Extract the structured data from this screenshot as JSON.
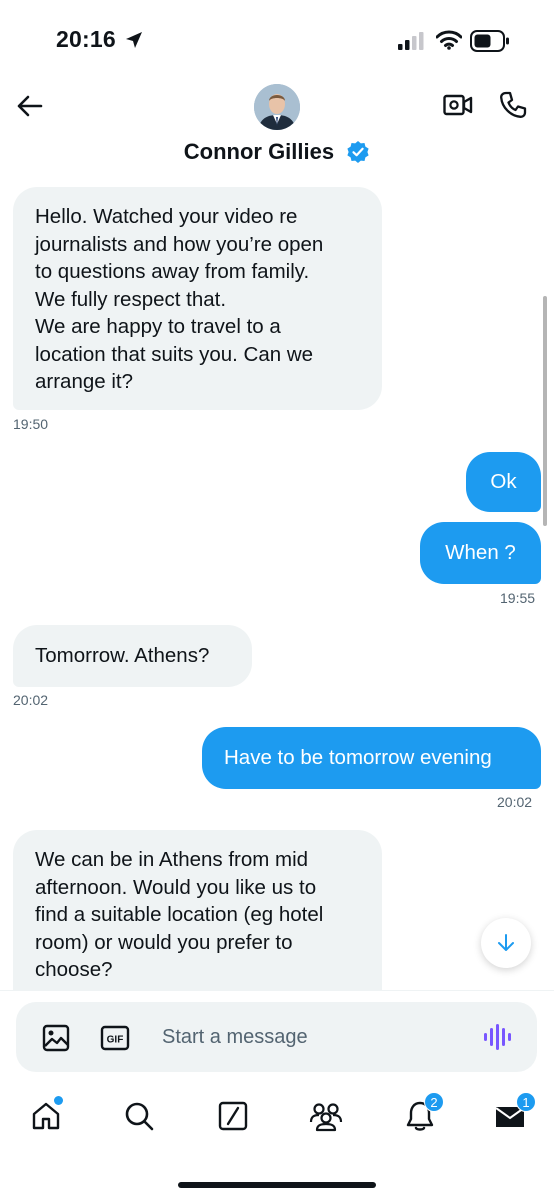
{
  "status_bar": {
    "time": "20:16"
  },
  "header": {
    "contact_name": "Connor Gillies"
  },
  "messages": [
    {
      "direction": "incoming",
      "text": "Hello. Watched your video re\njournalists and how you’re open\nto questions away from family.\nWe fully respect that.\nWe are happy to travel to a\nlocation that suits you. Can we\narrange it?",
      "time": "19:50"
    },
    {
      "direction": "outgoing",
      "text": "Ok"
    },
    {
      "direction": "outgoing",
      "text": "When ?",
      "time": "19:55"
    },
    {
      "direction": "incoming",
      "text": "Tomorrow. Athens?",
      "time": "20:02"
    },
    {
      "direction": "outgoing",
      "text": "Have to be tomorrow evening",
      "time": "20:02"
    },
    {
      "direction": "incoming",
      "text": "We can be in Athens from mid\nafternoon. Would you like us to\nfind a suitable location (eg hotel\nroom) or would you prefer to\nchoose?"
    }
  ],
  "composer": {
    "placeholder": "Start a message",
    "gif_label": "GIF"
  },
  "tabbar": {
    "notifications_badge": "2",
    "messages_badge": "1"
  },
  "colors": {
    "accent": "#1d9bf0",
    "bubble_incoming": "#eff3f4",
    "text_secondary": "#536471"
  }
}
